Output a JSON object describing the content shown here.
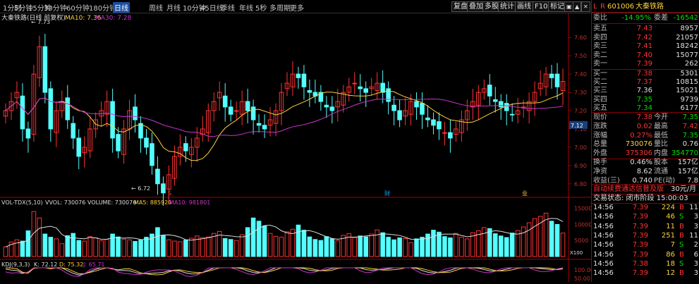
{
  "toolbar": {
    "periods": [
      "1分时",
      "5分钟",
      "15分钟",
      "30分钟",
      "60分钟",
      "180分钟",
      "日线",
      "周线",
      "月线",
      "10分钟",
      "45日线",
      "季线",
      "年线",
      "5秒",
      "多周期",
      "更多"
    ],
    "active_period": "日线",
    "right_buttons": [
      "复盘",
      "叠加",
      "多股",
      "统计",
      "画线",
      "F10",
      "标记"
    ],
    "window_icons": [
      "restore-icon",
      "chevron-up-icon",
      "close-icon"
    ]
  },
  "main_chart": {
    "legend": [
      "大秦铁路(日线 前复权)",
      "MA10: 7.36",
      "MA30: 7.28"
    ],
    "high_label": "7.73",
    "low_label": "6.72",
    "price_ticks": [
      "7.60",
      "7.50",
      "7.40",
      "7.30",
      "7.20",
      "7.10",
      "7.00",
      "6.90",
      "6.80"
    ],
    "current_price_tag": "7.12",
    "markers": [
      "S",
      "财",
      "业"
    ],
    "colors": {
      "up": "#ff3232",
      "down": "#54ffff",
      "ma10": "#ffd23a",
      "ma30": "#cc33cc",
      "bg": "#000000"
    }
  },
  "volume_chart": {
    "legend": [
      "VOL-TDX(5,10)",
      "VVOL: 730076",
      "VOLUME: 730076",
      "MA5: 885920",
      "MA10: 981801"
    ],
    "ticks": [
      "15000",
      "10000",
      "5000"
    ],
    "unit": "X100"
  },
  "kdj_chart": {
    "legend": [
      "KDJ(9,3,3)",
      "K: 72.12",
      "D: 75.32",
      "J: 65.71"
    ],
    "ticks": [
      "100.00",
      "50.00"
    ]
  },
  "quote": {
    "header_left": "L",
    "header_right": "R",
    "code": "601006",
    "name": "大秦铁路",
    "ratio_label": "委比",
    "ratio_value": "-14.95%",
    "diff_label": "委差",
    "diff_value": "-16542",
    "asks": [
      {
        "label": "卖五",
        "price": "7.43",
        "vol": "8957"
      },
      {
        "label": "卖四",
        "price": "7.42",
        "vol": "21057"
      },
      {
        "label": "卖三",
        "price": "7.41",
        "vol": "18242"
      },
      {
        "label": "卖二",
        "price": "7.40",
        "vol": "15077"
      },
      {
        "label": "卖一",
        "price": "7.39",
        "vol": "262"
      }
    ],
    "bids": [
      {
        "label": "买一",
        "price": "7.38",
        "vol": "5301"
      },
      {
        "label": "买二",
        "price": "7.37",
        "vol": "10815"
      },
      {
        "label": "买三",
        "price": "7.36",
        "vol": "15021"
      },
      {
        "label": "买四",
        "price": "7.35",
        "vol": "9739"
      },
      {
        "label": "买五",
        "price": "7.34",
        "vol": "6177"
      }
    ],
    "stats": [
      {
        "l1": "现价",
        "v1": "7.38",
        "l2": "今开",
        "v2": "7.35"
      },
      {
        "l1": "涨跌",
        "v1": "0.02",
        "l2": "最高",
        "v2": "7.42"
      },
      {
        "l1": "涨幅",
        "v1": "0.27%",
        "l2": "最低",
        "v2": "7.35"
      },
      {
        "l1": "总量",
        "v1": "730076",
        "l2": "量比",
        "v2": "0.76"
      },
      {
        "l1": "外盘",
        "v1": "375306",
        "l2": "内盘",
        "v2": "354770"
      },
      {
        "l1": "换手",
        "v1": "0.46%",
        "l2": "股本",
        "v2": "157亿"
      },
      {
        "l1": "净资",
        "v1": "8.62",
        "l2": "流通",
        "v2": "157亿"
      },
      {
        "l1": "收益(三)",
        "v1": "0.740",
        "l2": "PE(动)",
        "v2": "7.8"
      }
    ],
    "promo_text": "自动续费通达信普及版",
    "promo_price": "30元/月",
    "trade_status": "交易状态: 闭市阶段 15:00:03",
    "ticks": [
      {
        "time": "14:56",
        "price": "7.39",
        "vol": "224",
        "bs": "B",
        "n": "11"
      },
      {
        "time": "14:56",
        "price": "7.39",
        "vol": "46",
        "bs": "S",
        "n": "3"
      },
      {
        "time": "14:56",
        "price": "7.39",
        "vol": "11",
        "bs": "B",
        "n": "3"
      },
      {
        "time": "14:56",
        "price": "7.39",
        "vol": "251",
        "bs": "B",
        "n": "11"
      },
      {
        "time": "14:56",
        "price": "7.39",
        "vol": "7",
        "bs": "S",
        "n": "2"
      },
      {
        "time": "14:56",
        "price": "7.39",
        "vol": "86",
        "bs": "B",
        "n": "6"
      },
      {
        "time": "14:56",
        "price": "7.38",
        "vol": "18",
        "bs": "S",
        "n": "3"
      },
      {
        "time": "14:56",
        "price": "7.39",
        "vol": "12",
        "bs": "B",
        "n": "3"
      }
    ]
  },
  "chart_data": {
    "type": "candlestick",
    "price_range": [
      6.72,
      7.73
    ],
    "volume_range": [
      0,
      15000
    ],
    "closes": [
      7.2,
      7.25,
      7.3,
      7.1,
      7.05,
      7.4,
      7.55,
      7.3,
      7.1,
      7.2,
      7.25,
      7.15,
      7.05,
      6.95,
      7.0,
      7.1,
      7.15,
      7.2,
      7.25,
      7.05,
      6.98,
      7.1,
      7.2,
      7.15,
      7.05,
      7.0,
      6.9,
      6.8,
      6.75,
      6.85,
      6.95,
      7.0,
      6.98,
      7.0,
      7.05,
      7.1,
      7.2,
      7.25,
      7.3,
      7.22,
      7.18,
      7.2,
      7.25,
      7.2,
      7.15,
      7.12,
      7.1,
      7.15,
      7.2,
      7.3,
      7.35,
      7.4,
      7.38,
      7.33,
      7.3,
      7.28,
      7.25,
      7.22,
      7.2,
      7.25,
      7.3,
      7.33,
      7.35,
      7.32,
      7.3,
      7.33,
      7.35,
      7.3,
      7.25,
      7.2,
      7.15,
      7.2,
      7.25,
      7.22,
      7.18,
      7.15,
      7.12,
      7.1,
      7.08,
      7.05,
      7.1,
      7.15,
      7.2,
      7.25,
      7.3,
      7.32,
      7.28,
      7.25,
      7.22,
      7.2,
      7.18,
      7.2,
      7.22,
      7.25,
      7.3,
      7.35,
      7.4,
      7.38,
      7.33,
      7.36
    ],
    "volumes": [
      3000,
      4500,
      5200,
      4800,
      8000,
      14000,
      12000,
      7000,
      6000,
      5500,
      4000,
      6500,
      7200,
      5000,
      4800,
      6200,
      5800,
      4900,
      5300,
      7000,
      6100,
      5400,
      5200,
      4700,
      5100,
      6000,
      7000,
      9000,
      6500,
      5200,
      4800,
      4600,
      5100,
      5700,
      6400,
      5900,
      6100,
      7200,
      7800,
      5600,
      5300,
      5000,
      6800,
      9000,
      12000,
      11000,
      9500,
      7200,
      6300,
      6000,
      7700,
      8500,
      9800,
      8200,
      6100,
      5300,
      5000,
      6200,
      5500,
      4900,
      6600,
      7100,
      5900,
      6400,
      6100,
      7000,
      8300,
      7400,
      6000,
      5200,
      5800,
      5600,
      4300,
      5500,
      6000,
      7000,
      8200,
      7600,
      6200,
      5800,
      7200,
      6000,
      5500,
      7400,
      8000,
      9000,
      8700,
      7100,
      6400,
      5900,
      7300,
      8100,
      9200,
      10500,
      11800,
      12500,
      13500,
      11000,
      10000,
      7300
    ]
  }
}
